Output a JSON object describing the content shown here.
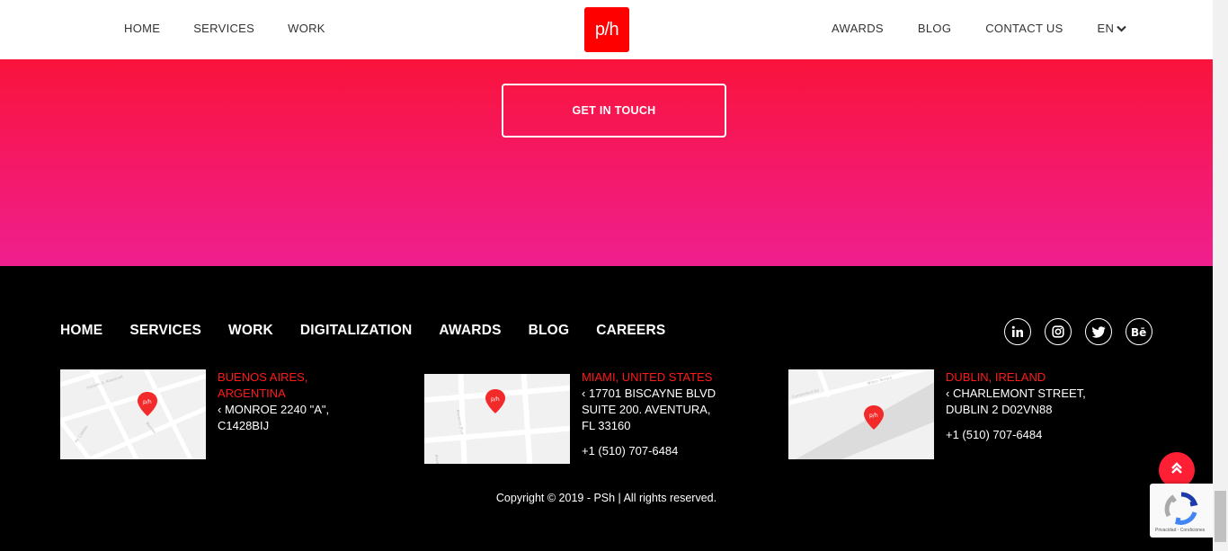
{
  "header": {
    "nav_left": [
      "HOME",
      "SERVICES",
      "WORK"
    ],
    "logo_text": "p/h",
    "nav_right": [
      "AWARDS",
      "BLOG",
      "CONTACT US"
    ],
    "language": "EN"
  },
  "hero": {
    "cta_label": "GET IN TOUCH"
  },
  "footer": {
    "nav": [
      "HOME",
      "SERVICES",
      "WORK",
      "DIGITALIZATION",
      "AWARDS",
      "BLOG",
      "CAREERS"
    ],
    "social_icons": [
      "linkedin-icon",
      "instagram-icon",
      "twitter-icon",
      "behance-icon"
    ],
    "offices": [
      {
        "city": "BUENOS AIRES, ARGENTINA",
        "address": [
          "‹ MONROE 2240 \"A\",",
          "C1428BIJ"
        ],
        "phone": ""
      },
      {
        "city": "MIAMI, UNITED STATES",
        "address": [
          "‹ 17701 BISCAYNE BLVD",
          "SUITE 200. AVENTURA,",
          "FL 33160"
        ],
        "phone": "+1 (510) 707-6484"
      },
      {
        "city": "DUBLIN, IRELAND",
        "address": [
          "‹ CHARLEMONT STREET,",
          "DUBLIN 2 D02VN88"
        ],
        "phone": "+1 (510) 707-6484"
      }
    ],
    "copyright": "Copyright © 2019 - PSh | All rights reserved."
  },
  "recaptcha": {
    "text": "Privacidad - Condiciones"
  },
  "colors": {
    "brand_red": "#ff0000",
    "hero_top": "#f9133b",
    "hero_bottom": "#ef1f8e",
    "city_red": "#ff1a1a"
  }
}
